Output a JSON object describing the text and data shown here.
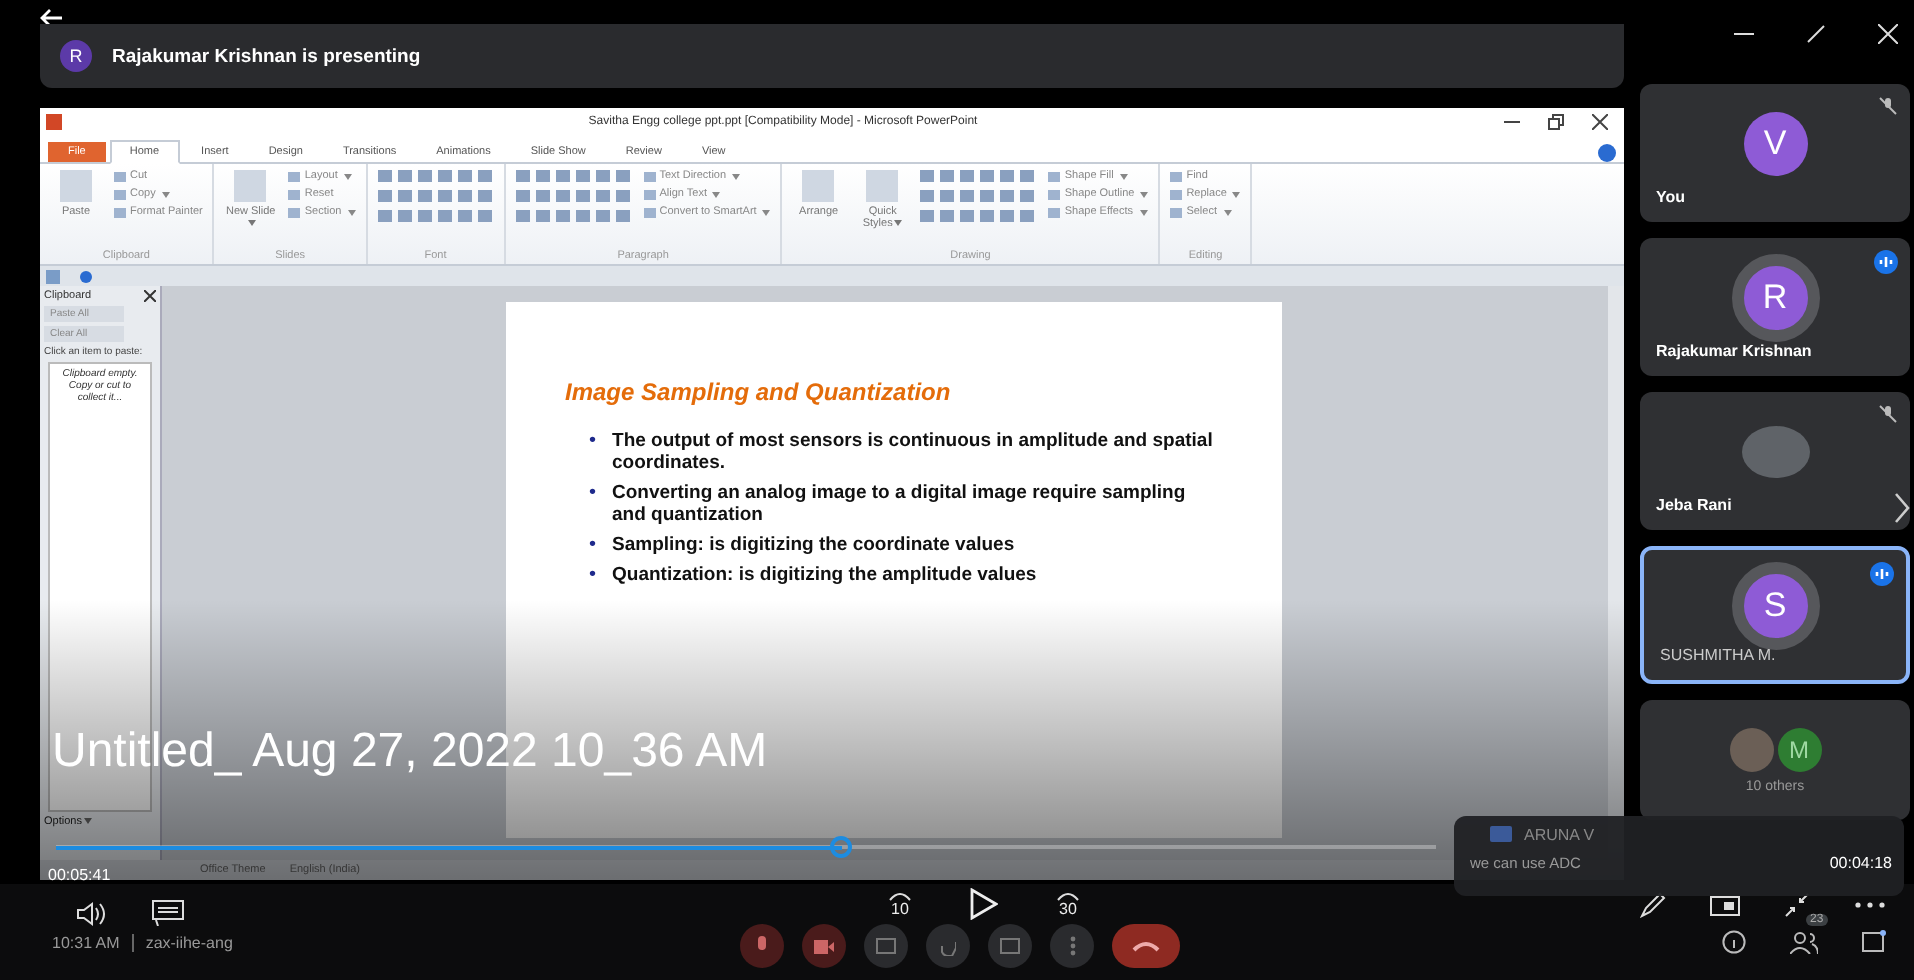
{
  "meeting": {
    "presenter_initial": "R",
    "banner": "Rajakumar Krishnan is presenting"
  },
  "ppt": {
    "title": "Savitha Engg college ppt.ppt [Compatibility Mode] - Microsoft PowerPoint",
    "tabs": [
      {
        "label": "File",
        "kind": "file",
        "selected": false
      },
      {
        "label": "Home",
        "kind": "tab",
        "selected": true
      },
      {
        "label": "Insert",
        "kind": "tab",
        "selected": false
      },
      {
        "label": "Design",
        "kind": "tab",
        "selected": false
      },
      {
        "label": "Transitions",
        "kind": "tab",
        "selected": false
      },
      {
        "label": "Animations",
        "kind": "tab",
        "selected": false
      },
      {
        "label": "Slide Show",
        "kind": "tab",
        "selected": false
      },
      {
        "label": "Review",
        "kind": "tab",
        "selected": false
      },
      {
        "label": "View",
        "kind": "tab",
        "selected": false
      }
    ],
    "ribbon_groups": [
      {
        "name": "Clipboard",
        "kind": "buttons",
        "big": [
          {
            "label": "Paste",
            "dropdown": false
          }
        ],
        "items": [
          {
            "label": "Cut",
            "dropdown": false
          },
          {
            "label": "Copy",
            "dropdown": true
          },
          {
            "label": "Format Painter",
            "dropdown": false
          }
        ]
      },
      {
        "name": "Slides",
        "kind": "buttons",
        "big": [
          {
            "label": "New Slide",
            "dropdown": true
          }
        ],
        "items": [
          {
            "label": "Layout",
            "dropdown": true
          },
          {
            "label": "Reset",
            "dropdown": false
          },
          {
            "label": "Section",
            "dropdown": true
          }
        ]
      },
      {
        "name": "Font",
        "kind": "icons"
      },
      {
        "name": "Paragraph",
        "kind": "mixed",
        "items": [
          {
            "label": "Text Direction",
            "dropdown": true
          },
          {
            "label": "Align Text",
            "dropdown": true
          },
          {
            "label": "Convert to SmartArt",
            "dropdown": true
          }
        ]
      },
      {
        "name": "Drawing",
        "kind": "mixed",
        "big": [
          {
            "label": "Arrange",
            "dropdown": false
          },
          {
            "label": "Quick Styles",
            "dropdown": true
          }
        ],
        "items": [
          {
            "label": "Shape Fill",
            "dropdown": true
          },
          {
            "label": "Shape Outline",
            "dropdown": true
          },
          {
            "label": "Shape Effects",
            "dropdown": true
          }
        ]
      },
      {
        "name": "Editing",
        "kind": "buttons",
        "items": [
          {
            "label": "Find",
            "dropdown": false
          },
          {
            "label": "Replace",
            "dropdown": true
          },
          {
            "label": "Select",
            "dropdown": true
          }
        ]
      }
    ],
    "clipboard_pane": {
      "title": "Clipboard",
      "buttons": [
        "Paste All",
        "Clear All"
      ],
      "hint": "Click an item to paste:",
      "empty": "Clipboard empty. Copy or cut to collect it...",
      "options": "Options"
    },
    "slide": {
      "title": "Image Sampling and Quantization",
      "marker": "•",
      "bullets": [
        "The output of most sensors is continuous in amplitude and spatial coordinates.",
        "Converting an analog image to a digital image require sampling and quantization",
        "Sampling: is digitizing the coordinate values",
        "Quantization: is digitizing the amplitude values"
      ]
    },
    "status": [
      "Office Theme",
      "English (India)"
    ]
  },
  "participants": [
    {
      "name": "You",
      "initial": "V",
      "kind": "avatar",
      "color": "#8e5bd6",
      "muted": true,
      "selected": false
    },
    {
      "name": "Rajakumar Krishnan",
      "initial": "R",
      "kind": "avatar",
      "color": "#8e5bd6",
      "muted": false,
      "selected": false
    },
    {
      "name": "Jeba Rani",
      "kind": "photo",
      "muted": true,
      "selected": false
    },
    {
      "name": "SUSHMITHA M.",
      "initial": "S",
      "kind": "avatar",
      "color": "#8e5bd6",
      "muted": false,
      "selected": true
    }
  ],
  "others": {
    "initial": "M",
    "color": "#2e7d32",
    "label": "10 others"
  },
  "player": {
    "title": "Untitled_ Aug 27, 2022 10_36 AM",
    "elapsed": "00:05:41",
    "remaining": "00:04:18",
    "level": 0.57,
    "skip_back": "10",
    "skip_forward": "30"
  },
  "chat_toast": {
    "sender": "ARUNA V",
    "message": "we can use ADC"
  },
  "footer": {
    "clock": "10:31 AM",
    "meeting_code": "zax-iihe-ang",
    "people_count": "23"
  }
}
